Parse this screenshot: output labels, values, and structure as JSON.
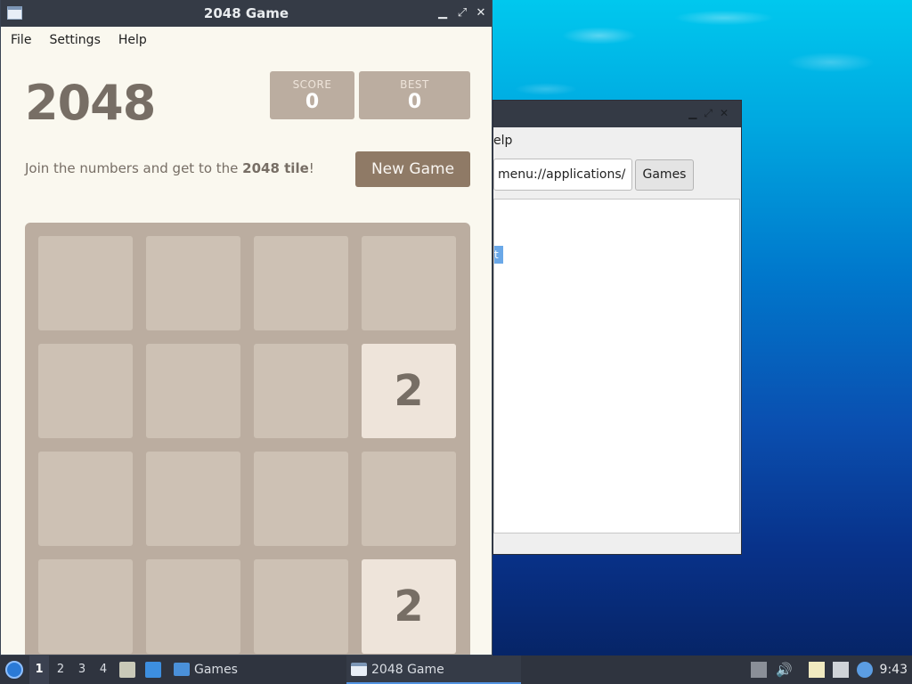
{
  "window": {
    "title": "2048 Game",
    "controls": {
      "minimize": "▁",
      "maximize": "⤢",
      "close": "✕"
    }
  },
  "menu": [
    "File",
    "Settings",
    "Help"
  ],
  "game": {
    "title": "2048",
    "score_label": "SCORE",
    "score": "0",
    "best_label": "BEST",
    "best": "0",
    "intro_prefix": "Join the numbers and get to the ",
    "intro_bold": "2048 tile",
    "intro_suffix": "!",
    "new_game_label": "New Game",
    "tiles": [
      {
        "row": 1,
        "col": 3,
        "value": "2"
      },
      {
        "row": 3,
        "col": 3,
        "value": "2"
      }
    ]
  },
  "background_window": {
    "menu_fragment": "elp",
    "path_value": "menu://applications/",
    "games_button": "Games",
    "selected_fragment": "t"
  },
  "taskbar": {
    "workspaces": [
      "1",
      "2",
      "3",
      "4"
    ],
    "tasks": [
      {
        "label": "Games"
      },
      {
        "label": "2048 Game"
      }
    ],
    "clock": "9:43"
  },
  "colors": {
    "board": "#bbada0",
    "cell": "#cdc1b4",
    "tile_2": "#eee4da",
    "text": "#776e65",
    "button": "#8f7a66"
  }
}
